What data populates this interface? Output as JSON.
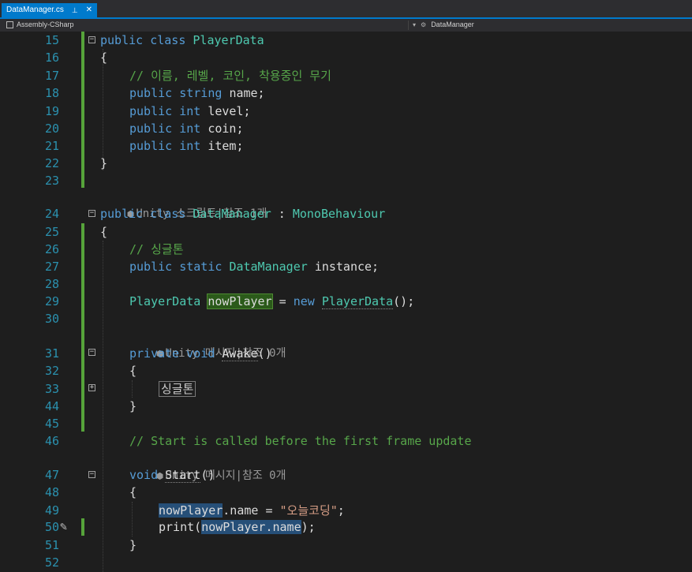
{
  "tab": {
    "title": "DataManager.cs",
    "pin_icon": "pin-icon",
    "close_icon": "close-icon"
  },
  "nav": {
    "project": "Assembly-CSharp",
    "member": "DataManager"
  },
  "lines": {
    "l15": {
      "num": "15",
      "text": "public class PlayerData"
    },
    "l16": {
      "num": "16",
      "text": "{"
    },
    "l17": {
      "num": "17",
      "text": "// 이름, 레벨, 코인, 착용중인 무기"
    },
    "l18": {
      "num": "18",
      "kw1": "public",
      "kw2": "string",
      "id": "name;"
    },
    "l19": {
      "num": "19",
      "kw1": "public",
      "kw2": "int",
      "id": "level;"
    },
    "l20": {
      "num": "20",
      "kw1": "public",
      "kw2": "int",
      "id": "coin;"
    },
    "l21": {
      "num": "21",
      "kw1": "public",
      "kw2": "int",
      "id": "item;"
    },
    "l22": {
      "num": "22",
      "text": "}"
    },
    "l23": {
      "num": "23"
    },
    "l24": {
      "num": "24",
      "kw": "public class",
      "ty": "DataManager",
      "sep": " : ",
      "base": "MonoBehaviour"
    },
    "l25": {
      "num": "25",
      "text": "{"
    },
    "l26": {
      "num": "26",
      "text": "// 싱글톤"
    },
    "l27": {
      "num": "27",
      "kw": "public static",
      "ty": "DataManager",
      "id": "instance;"
    },
    "l28": {
      "num": "28"
    },
    "l29": {
      "num": "29",
      "ty": "PlayerData",
      "var": "nowPlayer",
      "eq": " = ",
      "kw": "new",
      "ty2": "PlayerData",
      "tail": "();"
    },
    "l30": {
      "num": "30"
    },
    "l31": {
      "num": "31",
      "kw": "private void",
      "fn": "Awake",
      "tail": "()"
    },
    "l32": {
      "num": "32",
      "text": "{"
    },
    "l33": {
      "num": "33",
      "region": "싱글톤"
    },
    "l44": {
      "num": "44",
      "text": "}"
    },
    "l45": {
      "num": "45"
    },
    "l46": {
      "num": "46",
      "text": "// Start is called before the first frame update"
    },
    "l47": {
      "num": "47",
      "kw": "void",
      "fn": "Start",
      "tail": "()"
    },
    "l48": {
      "num": "48",
      "text": "{"
    },
    "l49": {
      "num": "49",
      "var": "nowPlayer",
      "mid": ".name = ",
      "str": "\"오늘코딩\"",
      "tail": ";"
    },
    "l50": {
      "num": "50",
      "fn": "print(",
      "var": "nowPlayer.name",
      "tail": ");"
    },
    "l51": {
      "num": "51",
      "text": "}"
    },
    "l52": {
      "num": "52"
    }
  },
  "lens": {
    "a": "Unity 스크립트|참조 1개",
    "b": "Unity 메시지|참조 0개",
    "c": "Unity 메시지|참조 0개"
  },
  "colors": {
    "keyword": "#569cd6",
    "type": "#4ec9b0",
    "comment": "#57a64a",
    "string": "#d69d85",
    "line_number": "#2b91af",
    "accent": "#007acc"
  }
}
